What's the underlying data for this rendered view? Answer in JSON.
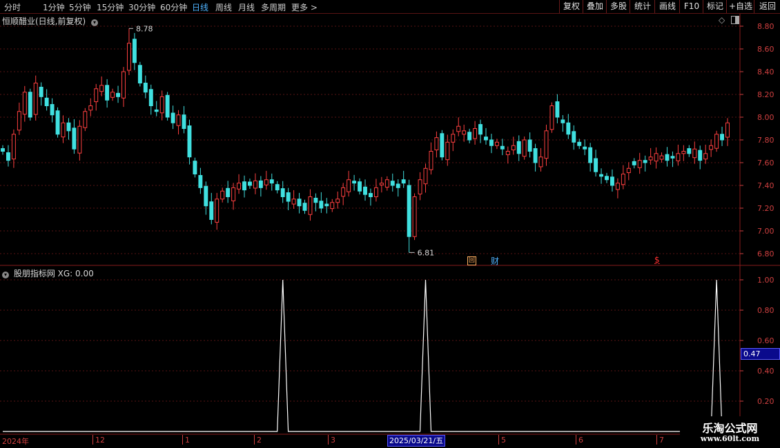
{
  "toolbar": {
    "periods": [
      "分时",
      "1分钟",
      "5分钟",
      "15分钟",
      "30分钟",
      "60分钟",
      "日线",
      "周线",
      "月线",
      "多周期",
      "更多"
    ],
    "active_period": "日线",
    "more_arrow": ">",
    "right_buttons": [
      "复权",
      "叠加",
      "多股",
      "统计",
      "画线",
      "F10",
      "标记",
      "+自选",
      "返回"
    ]
  },
  "main_panel": {
    "title": "恒顺醋业(日线,前复权)",
    "collapse_icon": "chevron-down-icon",
    "high_label": "8.78",
    "low_label": "6.81",
    "markers": {
      "hui": "回",
      "cai": "财",
      "dollar": "$"
    },
    "y_ticks": [
      "8.80",
      "8.60",
      "8.40",
      "8.20",
      "8.00",
      "7.80",
      "7.60",
      "7.40",
      "7.20",
      "7.00",
      "6.80"
    ]
  },
  "indicator_panel": {
    "title": "股朋指标网 XG: 0.00",
    "y_ticks": [
      "1.00",
      "0.80",
      "0.60",
      "0.40",
      "0.20"
    ],
    "current_value": "0.47"
  },
  "date_axis": {
    "labels": [
      "2024年",
      "12",
      "1",
      "2",
      "3",
      "5",
      "6",
      "7"
    ],
    "selected_date": "2025/03/21/五"
  },
  "watermark": {
    "line1": "乐淘公式网",
    "line2": "www.60lt.com"
  },
  "colors": {
    "up": "#ff4040",
    "down": "#40e0e0",
    "grid": "#5a1414",
    "axis": "#d04040",
    "active": "#4fb3ff"
  },
  "chart_data": {
    "type": "candlestick",
    "title": "恒顺醋业(日线,前复权)",
    "price_range": [
      6.75,
      8.88
    ],
    "annotated_high": 8.78,
    "annotated_low": 6.81,
    "closes": [
      7.7,
      7.62,
      7.85,
      8.05,
      8.22,
      8.0,
      8.3,
      8.18,
      8.1,
      8.02,
      7.85,
      7.95,
      7.88,
      7.72,
      7.92,
      8.05,
      8.1,
      8.25,
      8.28,
      8.15,
      8.22,
      8.18,
      8.4,
      8.65,
      8.48,
      8.3,
      8.22,
      8.1,
      8.05,
      8.18,
      8.0,
      7.95,
      8.02,
      7.9,
      7.65,
      7.5,
      7.38,
      7.22,
      7.1,
      7.28,
      7.35,
      7.3,
      7.38,
      7.42,
      7.36,
      7.4,
      7.44,
      7.38,
      7.45,
      7.42,
      7.36,
      7.3,
      7.26,
      7.28,
      7.22,
      7.18,
      7.3,
      7.25,
      7.2,
      7.22,
      7.25,
      7.28,
      7.38,
      7.45,
      7.42,
      7.35,
      7.32,
      7.3,
      7.38,
      7.42,
      7.45,
      7.4,
      7.38,
      7.42,
      6.95,
      7.3,
      7.45,
      7.55,
      7.7,
      7.82,
      7.65,
      7.78,
      7.85,
      7.92,
      7.88,
      7.8,
      7.9,
      7.85,
      7.8,
      7.75,
      7.78,
      7.72,
      7.7,
      7.75,
      7.68,
      7.8,
      7.7,
      7.6,
      7.65,
      7.88,
      8.1,
      8.0,
      7.95,
      7.85,
      7.78,
      7.75,
      7.72,
      7.6,
      7.52,
      7.48,
      7.45,
      7.4,
      7.42,
      7.5,
      7.55,
      7.58,
      7.62,
      7.6,
      7.65,
      7.68,
      7.66,
      7.62,
      7.64,
      7.68,
      7.7,
      7.68,
      7.72,
      7.62,
      7.68,
      7.75,
      7.85,
      7.8,
      7.95
    ],
    "xg_signal_days": [
      51,
      77,
      130
    ],
    "xg_range": [
      0,
      1
    ]
  }
}
